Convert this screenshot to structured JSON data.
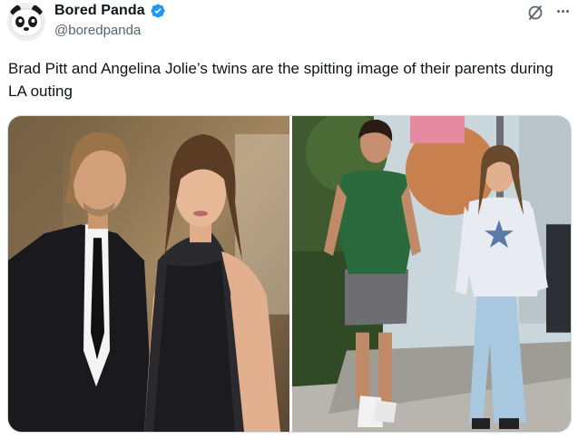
{
  "account": {
    "display_name": "Bored Panda",
    "handle": "@boredpanda",
    "avatar_icon": "panda-logo-icon",
    "verified_icon": "verified-badge-icon",
    "verified_color": "#1d9bf0"
  },
  "toolbar": {
    "grok_icon": "grok-icon",
    "more_icon": "more-options-icon"
  },
  "tweet": {
    "text": "Brad Pitt and Angelina Jolie’s twins are the spitting image of their parents during LA outing"
  },
  "media": {
    "photos": [
      {
        "subject": "couple at red carpet event"
      },
      {
        "subject": "teenage twins walking on sidewalk"
      }
    ]
  },
  "colors": {
    "text_primary": "#0f1419",
    "text_secondary": "#536471",
    "border": "#cfd9de"
  }
}
